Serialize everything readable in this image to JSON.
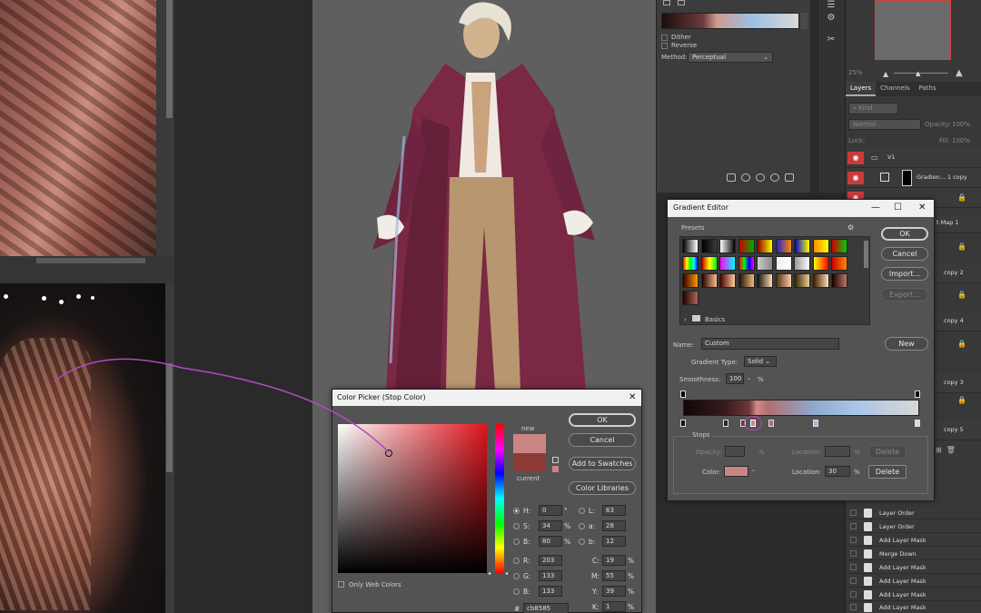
{
  "properties": {
    "dither_label": "Dither",
    "reverse_label": "Reverse",
    "method_label": "Method:",
    "method_value": "Perceptual"
  },
  "layers": {
    "tabs": [
      "Layers",
      "Channels",
      "Paths"
    ],
    "kind_placeholder": "Kind",
    "opacity_label": "Opacity:",
    "opacity_value": "100%",
    "blend_mode": "Normal",
    "lock_label": "Lock:",
    "fill_label": "Fill:",
    "fill_value": "100%",
    "zoom_value": "25%",
    "group_name": "V1",
    "rows": [
      {
        "name": "Gradien... 1 copy"
      },
      {
        "name": "t Map 1"
      },
      {
        "name": "copy 2"
      },
      {
        "name": "copy 4"
      },
      {
        "name": "copy 3"
      },
      {
        "name": "copy 5"
      }
    ]
  },
  "history": {
    "items": [
      "Layer Order",
      "Layer Order",
      "Add Layer Mask",
      "Merge Down",
      "Add Layer Mask",
      "Add Layer Mask",
      "Add Layer Mask",
      "Add Layer Mask"
    ]
  },
  "gradient_editor": {
    "title": "Gradient Editor",
    "presets_label": "Presets",
    "folder_label": "Basics",
    "ok": "OK",
    "cancel": "Cancel",
    "import": "Import...",
    "export": "Export...",
    "name_label": "Name:",
    "name_value": "Custom",
    "new": "New",
    "gradient_type_label": "Gradient Type:",
    "gradient_type_value": "Solid",
    "smoothness_label": "Smoothness:",
    "smoothness_value": "100",
    "smoothness_unit": "%",
    "stops_label": "Stops",
    "opacity_label": "Opacity:",
    "opacity_unit": "%",
    "location_label": "Location:",
    "location_unit": "%",
    "delete": "Delete",
    "color_label": "Color:",
    "color_location_label": "Location:",
    "color_location_value": "30",
    "color_location_unit": "%",
    "color_delete": "Delete",
    "stop_color": "#cb8585"
  },
  "color_picker": {
    "title": "Color Picker (Stop Color)",
    "new_label": "new",
    "current_label": "current",
    "ok": "OK",
    "cancel": "Cancel",
    "add_to_swatches": "Add to Swatches",
    "color_libraries": "Color Libraries",
    "only_web_colors": "Only Web Colors",
    "new_color": "#cb8585",
    "current_color": "#8c3b36",
    "h_label": "H:",
    "h_value": "0",
    "h_unit": "°",
    "s_label": "S:",
    "s_value": "34",
    "s_unit": "%",
    "b_label": "B:",
    "b_value": "80",
    "b_unit": "%",
    "r_label": "R:",
    "r_value": "203",
    "g_label": "G:",
    "g_value": "133",
    "bb_label": "B:",
    "bb_value": "133",
    "hex_label": "#",
    "hex_value": "cb8585",
    "l_label": "L:",
    "l_value": "63",
    "a_label": "a:",
    "a_value": "28",
    "lab_b_label": "b:",
    "lab_b_value": "12",
    "c_label": "C:",
    "c_value": "19",
    "c_unit": "%",
    "m_label": "M:",
    "m_value": "55",
    "m_unit": "%",
    "y_label": "Y:",
    "y_value": "39",
    "y_unit": "%",
    "k_label": "K:",
    "k_value": "1",
    "k_unit": "%"
  }
}
